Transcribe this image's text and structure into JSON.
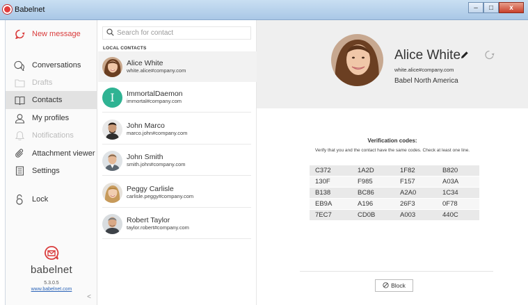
{
  "window": {
    "title": "Babelnet",
    "minimize_glyph": "–",
    "maximize_glyph": "□",
    "close_glyph": "x"
  },
  "nav": {
    "new_message": "New message",
    "conversations": "Conversations",
    "drafts": "Drafts",
    "contacts": "Contacts",
    "my_profiles": "My profiles",
    "notifications": "Notifications",
    "attachment_viewer": "Attachment viewer",
    "settings": "Settings",
    "lock": "Lock",
    "collapse_glyph": "<"
  },
  "brand": {
    "name": "babelnet",
    "version": "5.3.0.5",
    "link": "www.babelnet.com"
  },
  "search": {
    "placeholder": "Search for contact"
  },
  "contacts": {
    "section_title": "LOCAL CONTACTS",
    "items": [
      {
        "name": "Alice White",
        "email": "white.alice#company.com"
      },
      {
        "name": "ImmortalDaemon",
        "email": "immortal#company.com",
        "initial": "I"
      },
      {
        "name": "John Marco",
        "email": "marco.john#company.com"
      },
      {
        "name": "John Smith",
        "email": "smith.john#company.com"
      },
      {
        "name": "Peggy Carlisle",
        "email": "carlisle.peggy#company.com"
      },
      {
        "name": "Robert Taylor",
        "email": "taylor.robert#company.com"
      }
    ]
  },
  "detail": {
    "name": "Alice White",
    "email": "white.alice#company.com",
    "organization": "Babel North America",
    "verification_title": "Verification codes:",
    "verification_desc": "Verify that you and the contact have the same codes. Check at least one line.",
    "codes": [
      [
        "C372",
        "1A2D",
        "1F82",
        "B820"
      ],
      [
        "130F",
        "F985",
        "F157",
        "A03A"
      ],
      [
        "B138",
        "BC86",
        "A2A0",
        "1C34"
      ],
      [
        "EB9A",
        "A196",
        "26F3",
        "0F78"
      ],
      [
        "7EC7",
        "CD0B",
        "A003",
        "440C"
      ]
    ],
    "block_label": "Block"
  },
  "colors": {
    "accent_red": "#d93b3b",
    "letter_avatar": "#2fb393",
    "link_blue": "#2b64b8"
  }
}
